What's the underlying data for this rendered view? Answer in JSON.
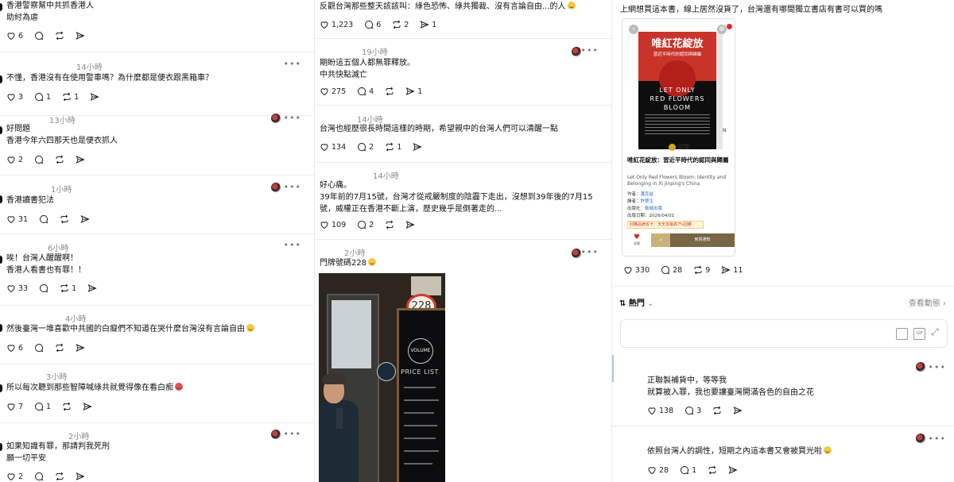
{
  "col1": {
    "posts": [
      {
        "time": "",
        "text": "香港警察幫中共抓香港人\n助紂為虐",
        "likes": "6",
        "comments": "",
        "reposts": ""
      },
      {
        "time": "14小時",
        "text": "不懂，香港沒有在使用警車嗎？為什麼都是便衣跟黑箱車？",
        "likes": "3",
        "comments": "1",
        "reposts": "1"
      },
      {
        "time": "13小時",
        "text": "好問題\n香港今年六四那天也是便衣抓人",
        "likes": "2",
        "comments": "",
        "reposts": ""
      },
      {
        "time": "1小時",
        "text": "香港讀書犯法",
        "likes": "31",
        "comments": "",
        "reposts": ""
      },
      {
        "time": "6小時",
        "text": "唉！台灣人醒醒啊！\n香港人看書也有罪！！",
        "likes": "33",
        "comments": "",
        "reposts": "1"
      },
      {
        "time": "4小時",
        "text": "然後臺灣一堆喜歡中共國的白癡們不知道在哭什麼台灣沒有言論自由",
        "likes": "6",
        "comments": "",
        "reposts": ""
      },
      {
        "time": "3小時",
        "text": "所以每次聽到那些智障喊綠共就覺得像在看白痴",
        "likes": "7",
        "comments": "1",
        "reposts": ""
      },
      {
        "time": "2小時",
        "text": "如果知識有罪，那請判我死刑\n願一切平安",
        "likes": "2",
        "comments": "",
        "reposts": ""
      }
    ]
  },
  "col2": {
    "posts": [
      {
        "time": "",
        "text": "反觀台灣那些整天該該叫：綠色恐怖、綠共獨裁、沒有言論自由...的人",
        "likes": "1,223",
        "comments": "6",
        "reposts": "2",
        "shares": "1"
      },
      {
        "time": "19小時",
        "text": "期盼這五個人都無罪釋放。\n中共快點滅亡",
        "likes": "275",
        "comments": "4",
        "reposts": "",
        "shares": "1"
      },
      {
        "time": "14小時",
        "text": "台灣也經歷很長時間這樣的時期，希望親中的台灣人們可以清醒一點",
        "likes": "134",
        "comments": "2",
        "reposts": "1",
        "shares": ""
      },
      {
        "time": "14小時",
        "text": "好心痛。\n39年前的7月15號，台灣才從戒嚴制度的陰霾下走出，沒想到39年後的7月15號，威權正在香港不斷上演，歷史幾乎是倒著走的...",
        "likes": "109",
        "comments": "2",
        "reposts": "",
        "shares": ""
      },
      {
        "time": "2小時",
        "text": "門牌號碼228",
        "photo_number": "228",
        "photo_sign": "PRICE LIST",
        "photo_logo": "VOLUME"
      }
    ]
  },
  "col3": {
    "top_text": "上網想買這本書，線上居然沒貨了，台灣還有哪間獨立書店有書可以買的嗎",
    "book": {
      "cover_title": "唯紅花綻放",
      "cover_subtitle": "習近平時代的認同與歸屬",
      "cover_english": "LET ONLY\nRED FLOWERS\nBLOOM",
      "trial_label": "試閱",
      "title": "唯紅花綻放：習近平時代的認同與歸屬",
      "english_title": "Let Only Red Flowers Bloom: Identity and Belonging in Xi Jinping's China",
      "author_label": "作者：",
      "author": "潘克益",
      "translator_label": "譯者：",
      "translator": "許楚生",
      "publisher_label": "出版社：",
      "publisher": "衛城出版",
      "date_label": "出版日期：",
      "date": "2026/04/01",
      "promo": "回購品牌名卡：天天享最高7%回饋",
      "btn_collect": "收藏",
      "btn_cart": "到貨通知",
      "tag": "N"
    },
    "stats": {
      "likes": "330",
      "comments": "28",
      "reposts": "9",
      "shares": "11"
    },
    "sort_label": "熱門",
    "view_activity": "查看動態",
    "replies": [
      {
        "text": "正聯製補貨中，等等我\n就算被入罪，我也要讓臺灣開滿各色的自由之花",
        "likes": "138",
        "comments": "3",
        "reposts": ""
      },
      {
        "text": "依照台灣人的調性，短期之內這本書又會被買光啦",
        "likes": "28",
        "comments": "1",
        "reposts": ""
      }
    ]
  }
}
